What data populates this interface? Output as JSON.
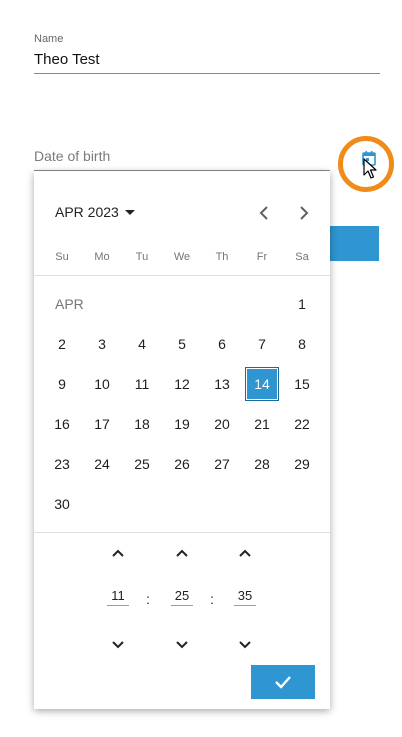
{
  "form": {
    "name_label": "Name",
    "name_value": "Theo Test",
    "dob_placeholder": "Date of birth"
  },
  "picker": {
    "month_year": "APR 2023",
    "month_tag": "APR",
    "weekdays": [
      "Su",
      "Mo",
      "Tu",
      "We",
      "Th",
      "Fr",
      "Sa"
    ],
    "days": [
      "1",
      "2",
      "3",
      "4",
      "5",
      "6",
      "7",
      "8",
      "9",
      "10",
      "11",
      "12",
      "13",
      "14",
      "15",
      "16",
      "17",
      "18",
      "19",
      "20",
      "21",
      "22",
      "23",
      "24",
      "25",
      "26",
      "27",
      "28",
      "29",
      "30"
    ],
    "selected_day": "14",
    "time": {
      "hours": "11",
      "minutes": "25",
      "seconds": "35",
      "separator": ":"
    }
  },
  "colors": {
    "accent": "#2f96d2",
    "highlight_ring": "#f08a19"
  },
  "icons": [
    "calendar-icon",
    "chevron-left-icon",
    "chevron-right-icon",
    "caret-down-icon",
    "chevron-up-icon",
    "chevron-down-icon",
    "check-icon",
    "mouse-cursor-icon"
  ]
}
